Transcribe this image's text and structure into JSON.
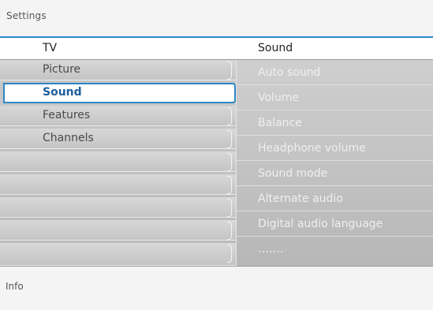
{
  "title": "Settings",
  "header": {
    "left": "TV",
    "right": "Sound"
  },
  "left_menu": [
    {
      "label": "Picture",
      "selected": false
    },
    {
      "label": "Sound",
      "selected": true
    },
    {
      "label": "Features",
      "selected": false
    },
    {
      "label": "Channels",
      "selected": false
    },
    {
      "label": "",
      "selected": false
    },
    {
      "label": "",
      "selected": false
    },
    {
      "label": "",
      "selected": false
    },
    {
      "label": "",
      "selected": false
    },
    {
      "label": "",
      "selected": false
    }
  ],
  "right_menu": [
    {
      "label": "Auto sound"
    },
    {
      "label": "Volume"
    },
    {
      "label": "Balance"
    },
    {
      "label": "Headphone volume"
    },
    {
      "label": "Sound mode"
    },
    {
      "label": "Alternate audio"
    },
    {
      "label": "Digital audio language"
    },
    {
      "label": "……."
    }
  ],
  "info": "Info",
  "colors": {
    "accent": "#2d86c6",
    "background": "#f2f2f2"
  }
}
